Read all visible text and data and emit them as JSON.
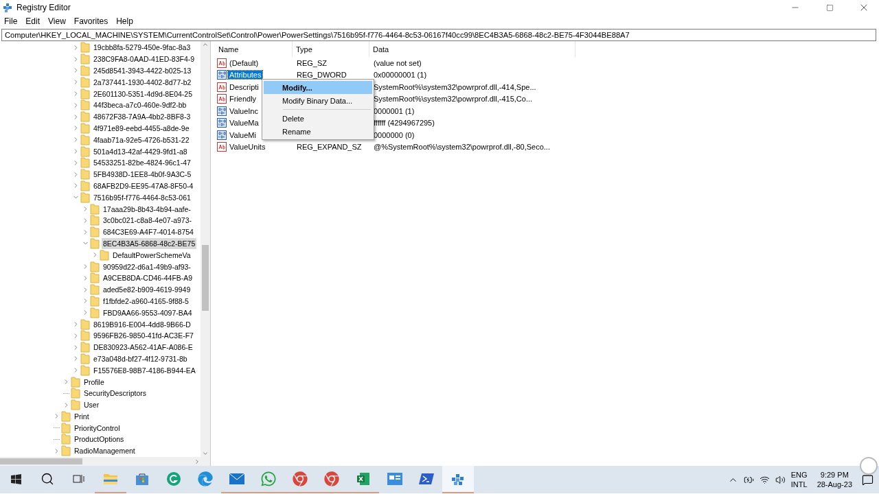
{
  "window": {
    "title": "Registry Editor"
  },
  "menu": [
    "File",
    "Edit",
    "View",
    "Favorites",
    "Help"
  ],
  "address": "Computer\\HKEY_LOCAL_MACHINE\\SYSTEM\\CurrentControlSet\\Control\\Power\\PowerSettings\\7516b95f-f776-4464-8c53-06167f40cc99\\8EC4B3A5-6868-48c2-BE75-4F3044BE88A7",
  "tree": {
    "items": [
      {
        "children": [
          {
            "children": [
              {
                "label": "19cbb8fa-5279-450e-9fac-8a3",
                "expandable": true,
                "expanded": false,
                "selected": false
              },
              {
                "label": "238C9FA8-0AAD-41ED-83F4-9",
                "expandable": true,
                "expanded": false,
                "selected": false
              },
              {
                "label": "245d8541-3943-4422-b025-13",
                "expandable": true,
                "expanded": false,
                "selected": false
              },
              {
                "label": "2a737441-1930-4402-8d77-b2",
                "expandable": true,
                "expanded": false,
                "selected": false
              },
              {
                "label": "2E601130-5351-4d9d-8E04-25",
                "expandable": true,
                "expanded": false,
                "selected": false
              },
              {
                "label": "44f3beca-a7c0-460e-9df2-bb",
                "expandable": true,
                "expanded": false,
                "selected": false
              },
              {
                "label": "48672F38-7A9A-4bb2-8BF8-3",
                "expandable": true,
                "expanded": false,
                "selected": false
              },
              {
                "label": "4f971e89-eebd-4455-a8de-9e",
                "expandable": true,
                "expanded": false,
                "selected": false
              },
              {
                "label": "4faab71a-92e5-4726-b531-22",
                "expandable": true,
                "expanded": false,
                "selected": false
              },
              {
                "label": "501a4d13-42af-4429-9fd1-a8",
                "expandable": true,
                "expanded": false,
                "selected": false
              },
              {
                "label": "54533251-82be-4824-96c1-47",
                "expandable": true,
                "expanded": false,
                "selected": false
              },
              {
                "label": "5FB4938D-1EE8-4b0f-9A3C-5",
                "expandable": true,
                "expanded": false,
                "selected": false
              },
              {
                "label": "68AFB2D9-EE95-47A8-8F50-4",
                "expandable": true,
                "expanded": false,
                "selected": false
              },
              {
                "label": "7516b95f-f776-4464-8c53-061",
                "expandable": true,
                "expanded": true,
                "selected": false,
                "children": [
                  {
                    "label": "17aaa29b-8b43-4b94-aafe-",
                    "expandable": true,
                    "expanded": false,
                    "selected": false
                  },
                  {
                    "label": "3c0bc021-c8a8-4e07-a973-",
                    "expandable": true,
                    "expanded": false,
                    "selected": false
                  },
                  {
                    "label": "684C3E69-A4F7-4014-8754",
                    "expandable": true,
                    "expanded": false,
                    "selected": false
                  },
                  {
                    "label": "8EC4B3A5-6868-48c2-BE75",
                    "expandable": true,
                    "expanded": true,
                    "selected": true,
                    "children": [
                      {
                        "label": "DefaultPowerSchemeVa",
                        "expandable": true,
                        "expanded": false,
                        "selected": false
                      }
                    ]
                  },
                  {
                    "label": "90959d22-d6a1-49b9-af93-",
                    "expandable": true,
                    "expanded": false,
                    "selected": false
                  },
                  {
                    "label": "A9CEB8DA-CD46-44FB-A9",
                    "expandable": true,
                    "expanded": false,
                    "selected": false
                  },
                  {
                    "label": "aded5e82-b909-4619-9949",
                    "expandable": true,
                    "expanded": false,
                    "selected": false
                  },
                  {
                    "label": "f1fbfde2-a960-4165-9f88-5",
                    "expandable": true,
                    "expanded": false,
                    "selected": false
                  },
                  {
                    "label": "FBD9AA66-9553-4097-BA4",
                    "expandable": true,
                    "expanded": false,
                    "selected": false
                  }
                ]
              },
              {
                "label": "8619B916-E004-4dd8-9B66-D",
                "expandable": true,
                "expanded": false,
                "selected": false
              },
              {
                "label": "9596FB26-9850-41fd-AC3E-F7",
                "expandable": true,
                "expanded": false,
                "selected": false
              },
              {
                "label": "DE830923-A562-41AF-A086-E",
                "expandable": true,
                "expanded": false,
                "selected": false
              },
              {
                "label": "e73a048d-bf27-4f12-9731-8b",
                "expandable": true,
                "expanded": false,
                "selected": false
              },
              {
                "label": "F15576E8-98B7-4186-B944-EA",
                "expandable": true,
                "expanded": false,
                "selected": false
              }
            ]
          },
          {
            "label": "Profile",
            "expandable": true,
            "expanded": false,
            "selected": false
          },
          {
            "label": "SecurityDescriptors",
            "expandable": false,
            "selected": false
          },
          {
            "label": "User",
            "expandable": true,
            "expanded": false,
            "selected": false
          }
        ]
      },
      {
        "label": "Print",
        "expandable": true,
        "expanded": false,
        "selected": false
      },
      {
        "label": "PriorityControl",
        "expandable": false,
        "selected": false
      },
      {
        "label": "ProductOptions",
        "expandable": false,
        "selected": false
      },
      {
        "label": "RadioManagement",
        "expandable": true,
        "expanded": false,
        "selected": false
      }
    ]
  },
  "values": {
    "columns": [
      "Name",
      "Type",
      "Data"
    ],
    "rows": [
      {
        "kind": "string",
        "name": "(Default)",
        "type": "REG_SZ",
        "data": "(value not set)",
        "selected": false
      },
      {
        "kind": "binary",
        "name": "Attributes",
        "type": "REG_DWORD",
        "data": "0x00000001 (1)",
        "selected": true
      },
      {
        "kind": "string",
        "name": "Descripti",
        "data": "SystemRoot%\\system32\\powrprof.dll,-414,Spe...",
        "selected": false
      },
      {
        "kind": "string",
        "name": "Friendly",
        "data": "SystemRoot%\\system32\\powrprof.dll,-415,Co...",
        "selected": false
      },
      {
        "kind": "binary",
        "name": "ValueInc",
        "data": "0000001 (1)",
        "selected": false
      },
      {
        "kind": "binary",
        "name": "ValueMa",
        "data": "ffffff (4294967295)",
        "selected": false
      },
      {
        "kind": "binary",
        "name": "ValueMi",
        "data": "0000000 (0)",
        "selected": false
      },
      {
        "kind": "string",
        "name": "ValueUnits",
        "type": "REG_EXPAND_SZ",
        "data": "@%SystemRoot%\\system32\\powrprof.dll,-80,Seco...",
        "selected": false
      }
    ]
  },
  "context_menu": {
    "items": [
      {
        "kind": "item",
        "label": "Modify...",
        "default": true,
        "selected": true
      },
      {
        "kind": "item",
        "label": "Modify Binary Data...",
        "default": false,
        "selected": false
      },
      {
        "kind": "separator"
      },
      {
        "kind": "item",
        "label": "Delete",
        "default": false,
        "selected": false
      },
      {
        "kind": "item",
        "label": "Rename",
        "default": false,
        "selected": false
      }
    ]
  },
  "taskbar": {
    "apps": [
      {
        "kind": "folder",
        "running": true,
        "active": false
      },
      {
        "kind": "store",
        "running": false,
        "active": false
      },
      {
        "kind": "grammar",
        "running": false,
        "active": false
      },
      {
        "kind": "edge",
        "running": false,
        "active": false
      },
      {
        "kind": "mail",
        "running": true,
        "active": false
      },
      {
        "kind": "chat",
        "running": true,
        "active": false
      },
      {
        "kind": "chrome",
        "running": true,
        "active": false
      },
      {
        "kind": "chrome",
        "running": true,
        "active": false
      },
      {
        "kind": "excel",
        "running": true,
        "active": false
      },
      {
        "kind": "card",
        "running": false,
        "active": false
      },
      {
        "kind": "terminal",
        "running": false,
        "active": false
      },
      {
        "kind": "registry",
        "running": true,
        "active": true
      }
    ],
    "language": "ENG",
    "layout": "INTL",
    "time": "9:29 PM",
    "date": "28-Aug-23"
  }
}
